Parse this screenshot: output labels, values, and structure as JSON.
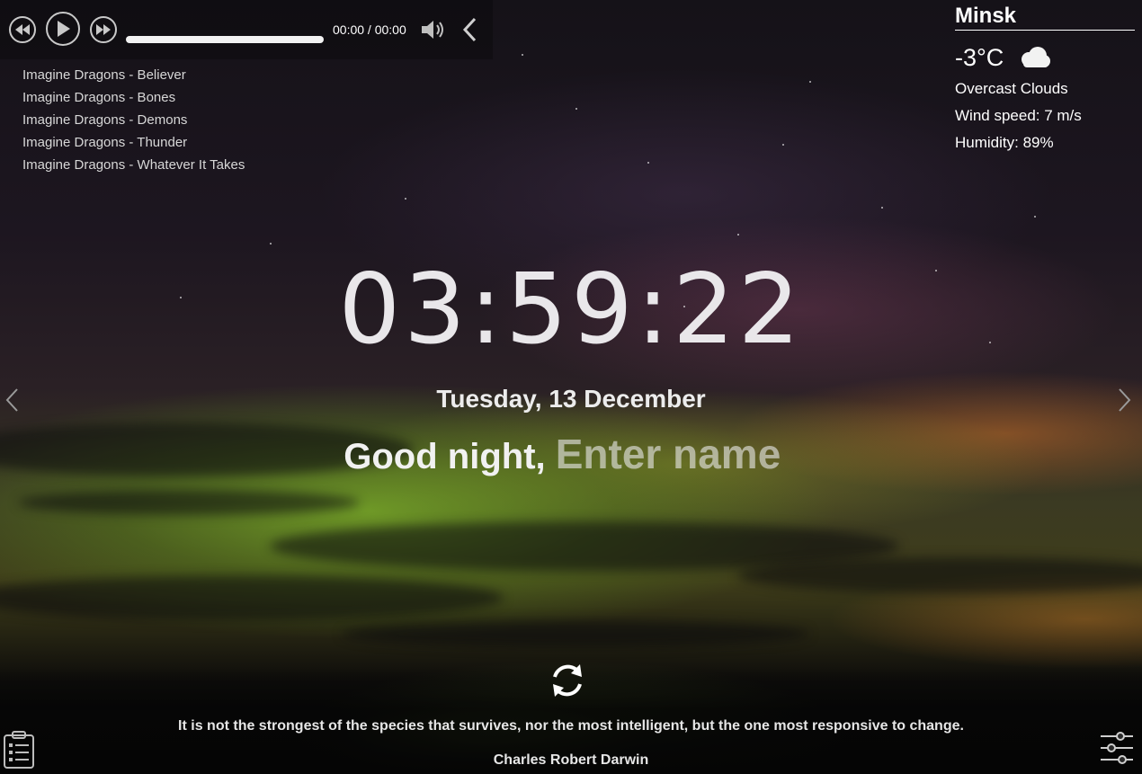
{
  "player": {
    "time": "00:00 / 00:00",
    "playlist": [
      "Imagine Dragons - Believer",
      "Imagine Dragons - Bones",
      "Imagine Dragons - Demons",
      "Imagine Dragons - Thunder",
      "Imagine Dragons - Whatever It Takes"
    ],
    "progress": 0
  },
  "weather": {
    "city": "Minsk",
    "temperature": "-3°C",
    "description": "Overcast Clouds",
    "wind": "Wind speed: 7 m/s",
    "humidity": "Humidity: 89%",
    "icon": "cloud-icon"
  },
  "clock": {
    "time": "03:59:22",
    "date": "Tuesday, 13 December"
  },
  "greeting": {
    "text": "Good night,",
    "name_placeholder": "Enter name",
    "name_value": ""
  },
  "quote": {
    "text": "It is not the strongest of the species that survives, nor the most intelligent, but the one most responsive to change.",
    "author": "Charles Robert Darwin"
  },
  "colors": {
    "text": "#ffffff",
    "muted": "#d7d7d7",
    "placeholder": "rgba(230,230,230,0.62)"
  }
}
